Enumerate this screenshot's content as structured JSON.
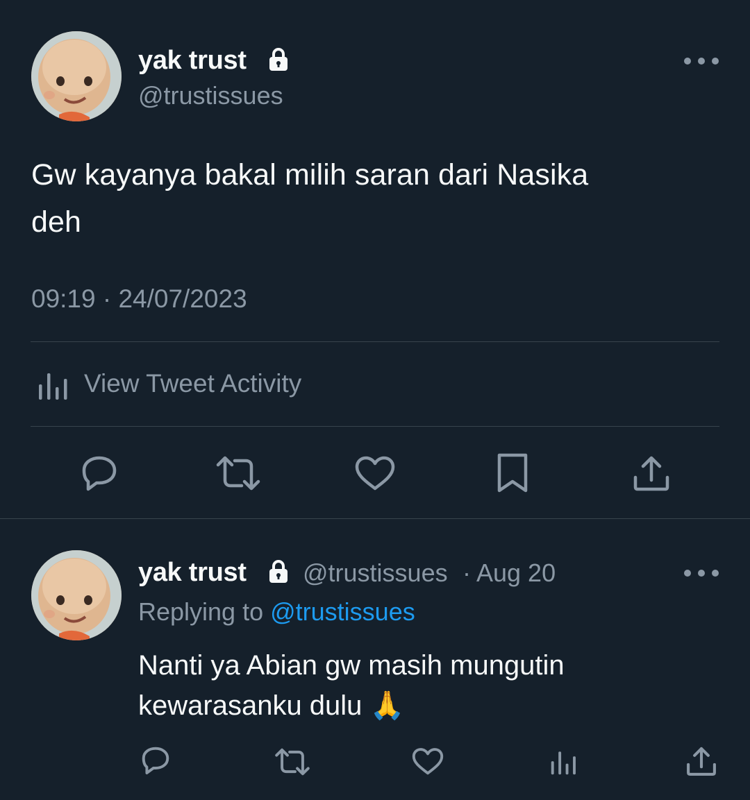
{
  "main_tweet": {
    "author": {
      "display_name": "yak trust",
      "handle": "@trustissues",
      "protected_icon": "lock-icon",
      "avatar": "avatar-image"
    },
    "text_line1": "Gw kayanya bakal milih saran dari Nasika",
    "text_line2": "deh",
    "timestamp": "09:19 · 24/07/2023",
    "activity_label": "View Tweet Activity",
    "actions": [
      "reply-icon",
      "retweet-icon",
      "like-icon",
      "bookmark-icon",
      "share-icon"
    ]
  },
  "reply_tweet": {
    "author": {
      "display_name": "yak trust",
      "handle": "@trustissues",
      "protected_icon": "lock-icon"
    },
    "date": "· Aug 20",
    "replying_to_prefix": "Replying to",
    "replying_to_handle": "@trustissues",
    "text_line1": "Nanti ya Abian gw masih mungutin",
    "text_line2": "kewarasanku dulu",
    "emoji": "🙏",
    "actions": [
      "reply-icon",
      "retweet-icon",
      "like-icon",
      "analytics-icon",
      "share-icon"
    ]
  },
  "colors": {
    "background": "#15202b",
    "primary_text": "#f7f9f9",
    "secondary_text": "#8b98a5",
    "link": "#1d9bf0",
    "divider": "#38444d"
  }
}
